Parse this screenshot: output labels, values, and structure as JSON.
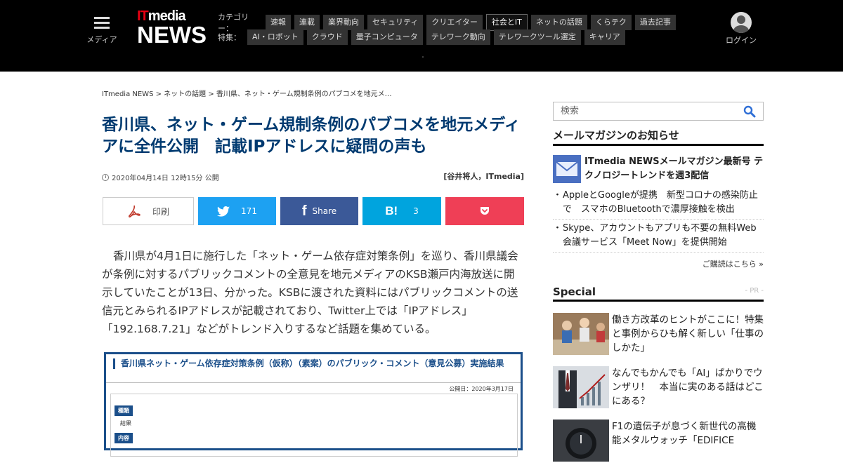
{
  "header": {
    "menu_label": "メディア",
    "logo_it_i": "IT",
    "logo_it_rest": "media",
    "logo_news": "NEWS",
    "category_label": "カテゴリー：",
    "categories": [
      "速報",
      "連載",
      "業界動向",
      "セキュリティ",
      "クリエイター",
      "社会とIT",
      "ネットの話題",
      "くらテク",
      "過去記事"
    ],
    "feature_label": "特集：",
    "features": [
      "AI・ロボット",
      "クラウド",
      "量子コンピュータ",
      "テレワーク動向",
      "テレワークツール選定",
      "キャリア"
    ],
    "dot": "・",
    "login_label": "ログイン"
  },
  "breadcrumb": "ITmedia NEWS > ネットの話題 > 香川県、ネット・ゲーム規制条例のパブコメを地元メ…",
  "article": {
    "title": "香川県、ネット・ゲーム規制条例のパブコメを地元メディアに全件公開　記載IPアドレスに疑問の声も",
    "date": "2020年04月14日 12時15分 公開",
    "author": "[谷井将人，ITmedia]",
    "share": {
      "print": "印刷",
      "twitter_count": "171",
      "facebook": "Share",
      "hatena_logo": "B!",
      "hatena_count": "3"
    },
    "body": "香川県が4月1日に施行した「ネット・ゲーム依存症対策条例」を巡り、香川県議会が条例に対するパブリックコメントの全意見を地元メディアのKSB瀬戸内海放送に開示していたことが13日、分かった。KSBに渡された資料にはパブリックコメントの送信元とみられるIPアドレスが記載されており、Twitter上では「IPアドレス」「192.168.7.21」などがトレンド入りするなど話題を集めている。",
    "figure": {
      "title": "香川県ネット・ゲーム依存症対策条例（仮称）（素案）のパブリック・コメント（意見公募）実施結果",
      "date": "公開日：2020年3月17日",
      "label1": "種類",
      "value1": "結果",
      "label2": "内容"
    }
  },
  "sidebar": {
    "search_placeholder": "検索",
    "mailmag_heading": "メールマガジンのお知らせ",
    "mail_feature": "ITmedia NEWSメールマガジン最新号 テクノロジートレンドを週3配信",
    "mail_items": [
      "AppleとGoogleが提携　新型コロナの感染防止で　スマホのBluetoothで濃厚接触を検出",
      "Skype、アカウントもアプリも不要の無料Web会議サービス「Meet Now」を提供開始"
    ],
    "subscribe": "ご購読はこちら »",
    "special_heading": "Special",
    "pr": "- PR -",
    "special_items": [
      "働き方改革のヒントがここに！特集と事例からひも解く新しい「仕事のしかた」",
      "なんでもかんでも「AI」ばかりでウンザリ！　本当に実のある話はどこにある？",
      "F1の遺伝子が息づく新世代の高機能メタルウォッチ「EDIFICE"
    ]
  },
  "colors": {
    "title": "#003a70",
    "twitter": "#1da1f2",
    "facebook": "#3b5998",
    "hatena": "#00a4de",
    "pocket": "#ef3f56",
    "logo_accent": "#e60012"
  }
}
